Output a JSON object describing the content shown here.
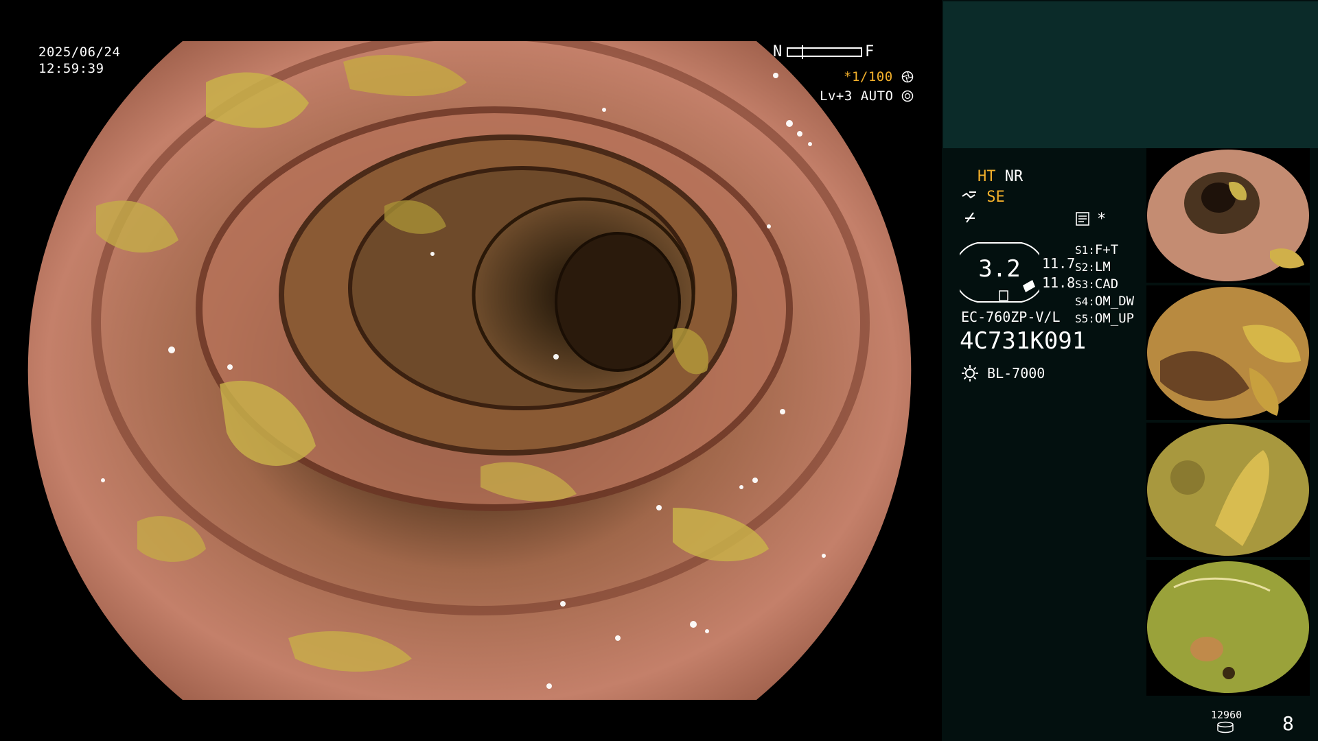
{
  "overlay": {
    "date": "2025/06/24",
    "time": "12:59:39",
    "nf_near": "N",
    "nf_far": "F",
    "shutter": "*1/100",
    "iris": "Lv+3 AUTO"
  },
  "panel": {
    "mode_ht": "HT",
    "mode_nr": "NR",
    "mode_se": "SE",
    "star": "*",
    "zoom": "3.2",
    "val1": "11.7",
    "val2": "11.8",
    "scope_model": "EC-760ZP-V/L",
    "serial": "4C731K091",
    "light_source": "BL-7000",
    "s_keys": [
      "S1:",
      "S2:",
      "S3:",
      "S4:",
      "S5:"
    ],
    "s_values": [
      "F+T",
      "LM",
      "CAD",
      "OM_DW",
      "OM_UP"
    ],
    "counter": "12960",
    "page_number": "8"
  },
  "colors": {
    "accent_orange": "#f3b02b",
    "panel_bg": "#03100f",
    "panel_top": "#0b2b29"
  },
  "icons": [
    "shutter-icon",
    "iris-icon",
    "structure-enhance-icon",
    "color-enhance-icon",
    "memo-icon",
    "light-source-icon",
    "storage-icon"
  ]
}
